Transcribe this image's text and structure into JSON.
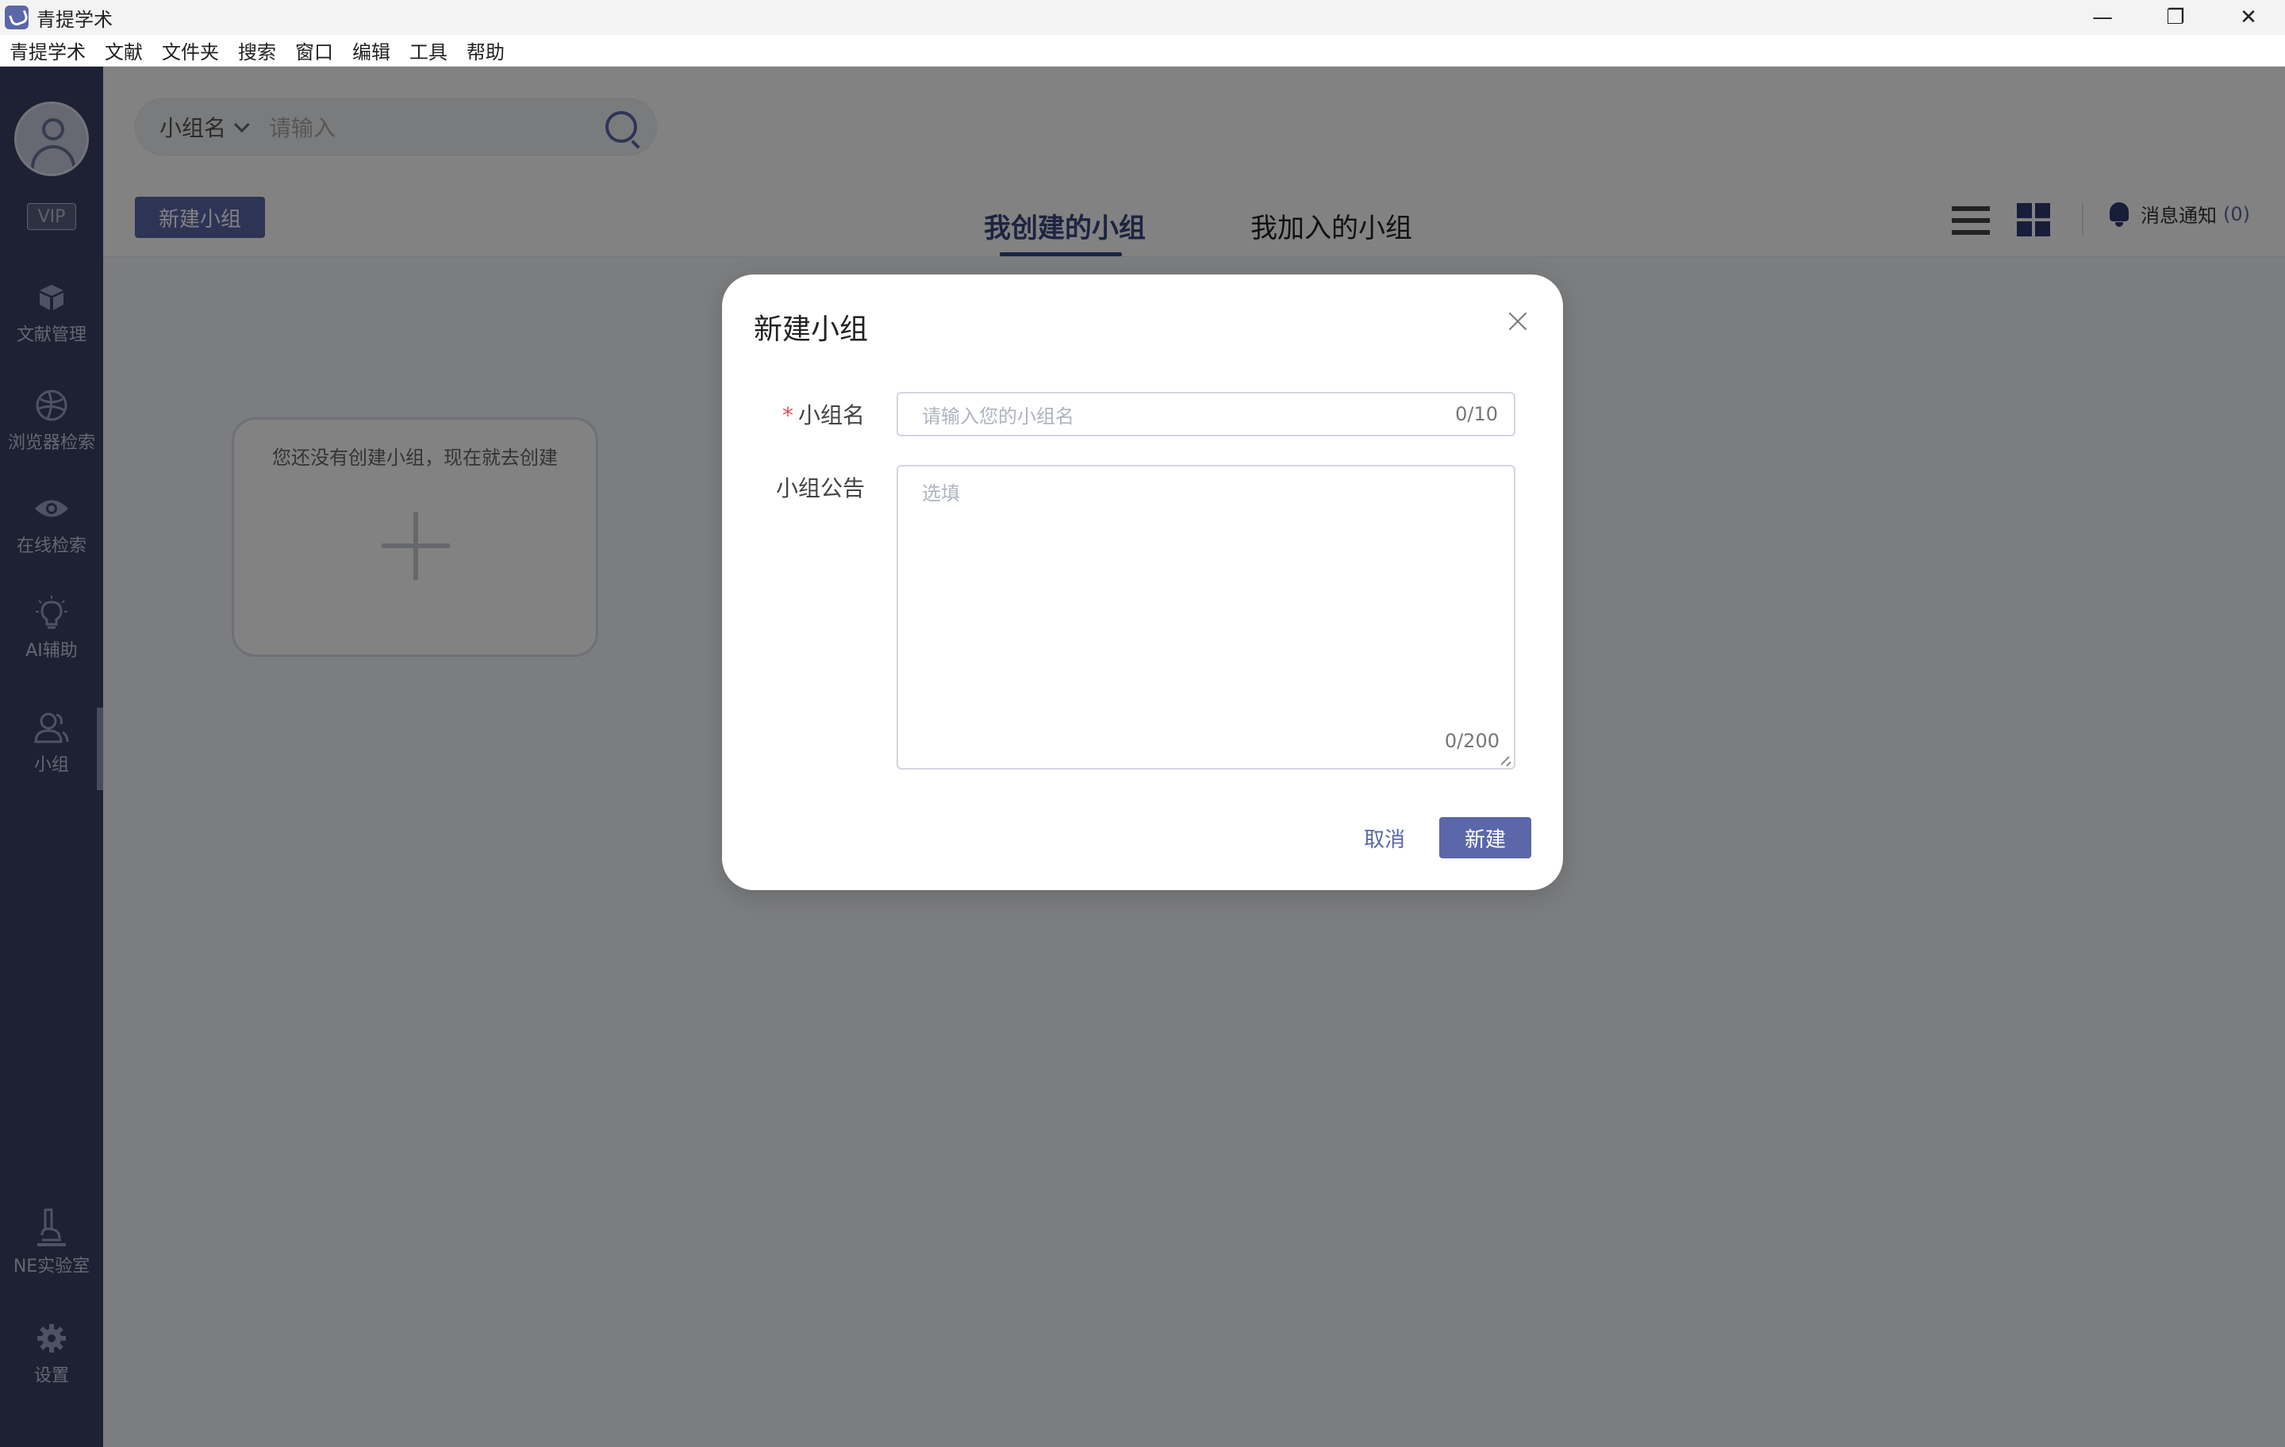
{
  "app": {
    "title": "青提学术"
  },
  "window_controls": {
    "minimize": "—",
    "restore": "❐",
    "close": "✕"
  },
  "menu": [
    "青提学术",
    "文献",
    "文件夹",
    "搜索",
    "窗口",
    "编辑",
    "工具",
    "帮助"
  ],
  "sidebar": {
    "vip": "VIP",
    "items": [
      {
        "label": "文献管理",
        "icon": "box-icon"
      },
      {
        "label": "浏览器检索",
        "icon": "browser-icon"
      },
      {
        "label": "在线检索",
        "icon": "eye-icon"
      },
      {
        "label": "AI辅助",
        "icon": "bulb-icon"
      },
      {
        "label": "小组",
        "icon": "group-icon",
        "active": true
      },
      {
        "label": "NE实验室",
        "icon": "microscope-icon"
      },
      {
        "label": "设置",
        "icon": "gear-icon"
      }
    ]
  },
  "search": {
    "type": "小组名",
    "placeholder": "请输入"
  },
  "toolbar": {
    "new_group": "新建小组",
    "tabs": [
      "我创建的小组",
      "我加入的小组"
    ],
    "active_tab": 0,
    "notify_label": "消息通知",
    "notify_count": "(0)"
  },
  "empty_state": {
    "text": "您还没有创建小组，现在就去创建"
  },
  "dialog": {
    "title": "新建小组",
    "name_label": "小组名",
    "name_placeholder": "请输入您的小组名",
    "name_count": "0/10",
    "notice_label": "小组公告",
    "notice_placeholder": "选填",
    "notice_count": "0/200",
    "cancel": "取消",
    "create": "新建"
  },
  "colors": {
    "accent": "#5a67a8",
    "sidebar": "#3a4165",
    "required": "#e34d59"
  }
}
